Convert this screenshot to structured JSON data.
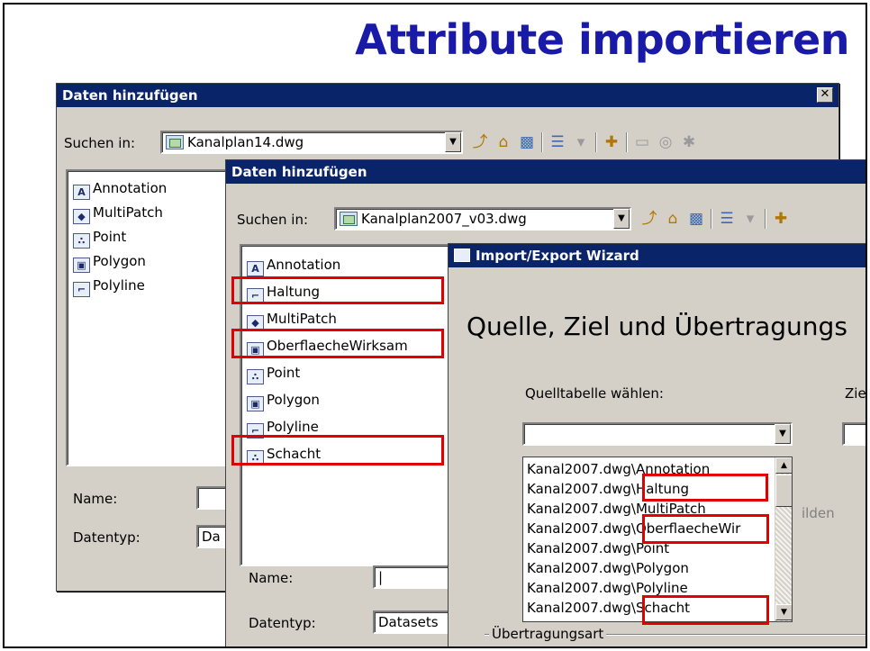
{
  "slide": {
    "title": "Attribute importieren",
    "title_color": "#1a1aa8"
  },
  "dialog_back": {
    "title": "Daten hinzufügen",
    "close_glyph": "✕",
    "look_in_label": "Suchen in:",
    "look_in_value": "Kanalplan14.dwg",
    "items": [
      {
        "label": "Annotation",
        "icon": "annotation-icon",
        "glyph": "A"
      },
      {
        "label": "MultiPatch",
        "icon": "multipatch-icon",
        "glyph": "◆"
      },
      {
        "label": "Point",
        "icon": "point-icon",
        "glyph": "∴"
      },
      {
        "label": "Polygon",
        "icon": "polygon-icon",
        "glyph": "▣"
      },
      {
        "label": "Polyline",
        "icon": "polyline-icon",
        "glyph": "⌐"
      }
    ],
    "name_label": "Name:",
    "name_value": "",
    "type_label": "Datentyp:",
    "type_value": "Da"
  },
  "dialog_mid": {
    "title": "Daten hinzufügen",
    "look_in_label": "Suchen in:",
    "look_in_value": "Kanalplan2007_v03.dwg",
    "items": [
      {
        "label": "Annotation",
        "icon": "annotation-icon",
        "glyph": "A"
      },
      {
        "label": "Haltung",
        "icon": "polyline-icon",
        "glyph": "⌐"
      },
      {
        "label": "MultiPatch",
        "icon": "multipatch-icon",
        "glyph": "◆"
      },
      {
        "label": "OberflaecheWirksam",
        "icon": "polygon-icon",
        "glyph": "▣"
      },
      {
        "label": "Point",
        "icon": "point-icon",
        "glyph": "∴"
      },
      {
        "label": "Polygon",
        "icon": "polygon-icon",
        "glyph": "▣"
      },
      {
        "label": "Polyline",
        "icon": "polyline-icon",
        "glyph": "⌐"
      },
      {
        "label": "Schacht",
        "icon": "point-icon",
        "glyph": "∴"
      }
    ],
    "name_label": "Name:",
    "name_value": "|",
    "type_label": "Datentyp:",
    "type_value": "Datasets"
  },
  "wizard": {
    "title": "Import/Export Wizard",
    "heading": "Quelle, Ziel und Übertragungs",
    "source_label": "Quelltabelle wählen:",
    "target_label": "Zielt",
    "source_value": "",
    "source_items": [
      "Kanal2007.dwg\\Annotation",
      "Kanal2007.dwg\\Haltung",
      "Kanal2007.dwg\\MultiPatch",
      "Kanal2007.dwg\\OberflaecheWir",
      "Kanal2007.dwg\\Point",
      "Kanal2007.dwg\\Polygon",
      "Kanal2007.dwg\\Polyline",
      "Kanal2007.dwg\\Schacht"
    ],
    "partial_label": "ilden",
    "group_label": "Übertragungsart"
  },
  "colors": {
    "titlebar": "#0a246a",
    "dialog_face": "#d4d0c8",
    "highlight_box": "#e00000"
  }
}
